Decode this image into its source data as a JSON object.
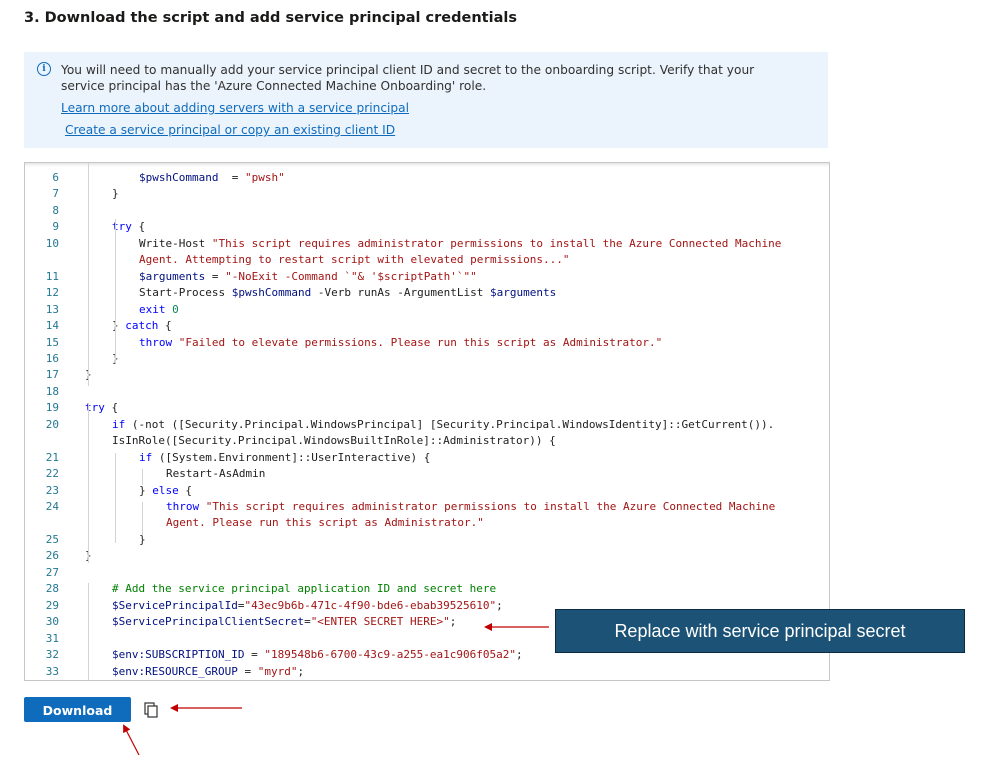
{
  "section": {
    "heading": "3. Download the script and add service principal credentials"
  },
  "info": {
    "icon": "info-icon",
    "message": "You will need to manually add your service principal client ID and secret to the onboarding script. Verify that your service principal has the 'Azure Connected Machine Onboarding' role.",
    "links": [
      "Learn more about adding servers with a service principal",
      "Create a service principal or copy an existing client ID"
    ]
  },
  "code": {
    "lines": [
      {
        "n": "6",
        "parts": [
          [
            "var",
            "$pwshCommand"
          ],
          [
            "",
            "  = "
          ],
          [
            "str",
            "\"pwsh\""
          ]
        ]
      },
      {
        "n": "7",
        "parts": [
          [
            "",
            "}"
          ]
        ]
      },
      {
        "n": "8",
        "parts": []
      },
      {
        "n": "9",
        "parts": [
          [
            "kw",
            "try"
          ],
          [
            "",
            " {"
          ]
        ]
      },
      {
        "n": "10",
        "parts": [
          [
            "",
            "Write-Host "
          ],
          [
            "str",
            "\"This script requires administrator permissions to install the Azure Connected Machine"
          ]
        ]
      },
      {
        "n": "",
        "parts": [
          [
            "str",
            "Agent. Attempting to restart script with elevated permissions...\""
          ]
        ]
      },
      {
        "n": "11",
        "parts": [
          [
            "var",
            "$arguments"
          ],
          [
            "",
            " = "
          ],
          [
            "str",
            "\"-NoExit -Command `\"& '$scriptPath'`\"\""
          ]
        ]
      },
      {
        "n": "12",
        "parts": [
          [
            "",
            "Start-Process "
          ],
          [
            "var",
            "$pwshCommand"
          ],
          [
            "",
            " -Verb runAs -ArgumentList "
          ],
          [
            "var",
            "$arguments"
          ]
        ]
      },
      {
        "n": "13",
        "parts": [
          [
            "kw",
            "exit"
          ],
          [
            " ",
            " "
          ],
          [
            "num",
            "0"
          ]
        ]
      },
      {
        "n": "14",
        "parts": [
          [
            "",
            "} "
          ],
          [
            "kw",
            "catch"
          ],
          [
            "",
            " {"
          ]
        ]
      },
      {
        "n": "15",
        "parts": [
          [
            "kw",
            "throw"
          ],
          [
            "",
            " "
          ],
          [
            "str",
            "\"Failed to elevate permissions. Please run this script as Administrator.\""
          ]
        ]
      },
      {
        "n": "16",
        "parts": [
          [
            "",
            "}"
          ]
        ]
      },
      {
        "n": "17",
        "parts": [
          [
            "",
            "}"
          ]
        ]
      },
      {
        "n": "18",
        "parts": []
      },
      {
        "n": "19",
        "parts": [
          [
            "kw",
            "try"
          ],
          [
            "",
            " {"
          ]
        ]
      },
      {
        "n": "20",
        "parts": [
          [
            "kw",
            "if"
          ],
          [
            "",
            " (-not ([Security.Principal.WindowsPrincipal] [Security.Principal.WindowsIdentity]::GetCurrent())."
          ]
        ]
      },
      {
        "n": "",
        "parts": [
          [
            "",
            "IsInRole([Security.Principal.WindowsBuiltInRole]::Administrator)) {"
          ]
        ]
      },
      {
        "n": "21",
        "parts": [
          [
            "kw",
            "if"
          ],
          [
            "",
            " ([System.Environment]::UserInteractive) {"
          ]
        ]
      },
      {
        "n": "22",
        "parts": [
          [
            "",
            "Restart-AsAdmin"
          ]
        ]
      },
      {
        "n": "23",
        "parts": [
          [
            "",
            "} "
          ],
          [
            "kw",
            "else"
          ],
          [
            "",
            " {"
          ]
        ]
      },
      {
        "n": "24",
        "parts": [
          [
            "kw",
            "throw"
          ],
          [
            "",
            " "
          ],
          [
            "str",
            "\"This script requires administrator permissions to install the Azure Connected Machine"
          ]
        ]
      },
      {
        "n": "",
        "parts": [
          [
            "str",
            "Agent. Please run this script as Administrator.\""
          ]
        ]
      },
      {
        "n": "25",
        "parts": [
          [
            "",
            "}"
          ]
        ]
      },
      {
        "n": "26",
        "parts": [
          [
            "",
            "}"
          ]
        ]
      },
      {
        "n": "27",
        "parts": []
      },
      {
        "n": "28",
        "parts": [
          [
            "cmt",
            "# Add the service principal application ID and secret here"
          ]
        ]
      },
      {
        "n": "29",
        "parts": [
          [
            "var",
            "$ServicePrincipalId"
          ],
          [
            "",
            "="
          ],
          [
            "str",
            "\"43ec9b6b-471c-4f90-bde6-ebab39525610\""
          ],
          [
            "",
            ";"
          ]
        ]
      },
      {
        "n": "30",
        "parts": [
          [
            "var",
            "$ServicePrincipalClientSecret"
          ],
          [
            "",
            "="
          ],
          [
            "str",
            "\"<ENTER SECRET HERE>\""
          ],
          [
            "",
            ";"
          ]
        ]
      },
      {
        "n": "31",
        "parts": []
      },
      {
        "n": "32",
        "parts": [
          [
            "var",
            "$env:SUBSCRIPTION_ID"
          ],
          [
            "",
            " = "
          ],
          [
            "str",
            "\"189548b6-6700-43c9-a255-ea1c906f05a2\""
          ],
          [
            "",
            ";"
          ]
        ]
      },
      {
        "n": "33",
        "parts": [
          [
            "var",
            "$env:RESOURCE_GROUP"
          ],
          [
            "",
            " = "
          ],
          [
            "str",
            "\"myrd\""
          ],
          [
            "",
            ";"
          ]
        ]
      }
    ]
  },
  "actions": {
    "download_label": "Download",
    "copy_icon": "copy-icon"
  },
  "callout": {
    "text": "Replace with service principal secret"
  },
  "colors": {
    "accent": "#0f6cbd",
    "info_bg": "#ebf3fc",
    "callout_bg": "#1b5276",
    "annotation_arrow": "#c00000"
  }
}
